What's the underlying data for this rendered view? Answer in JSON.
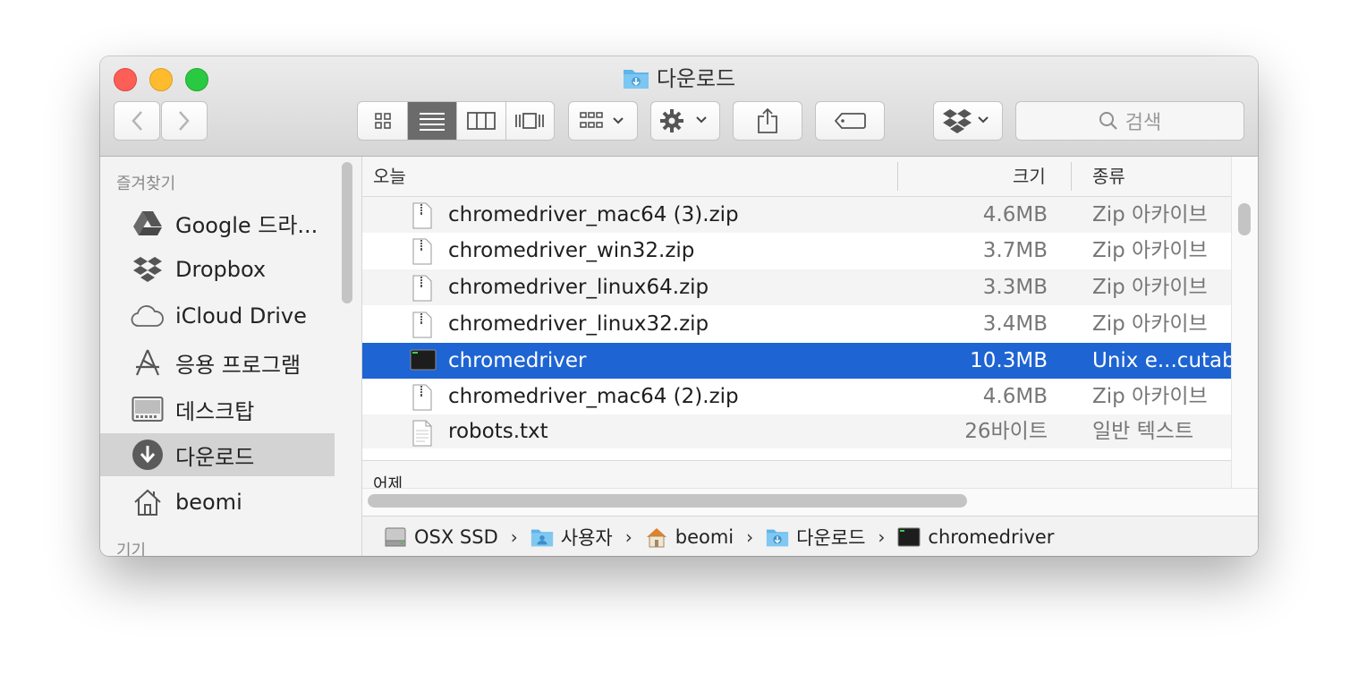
{
  "window": {
    "title": "다운로드"
  },
  "toolbar": {
    "back": "‹",
    "forward": "›",
    "search_placeholder": "검색"
  },
  "sidebar": {
    "favorites_header": "즐겨찾기",
    "items": [
      {
        "label": "Google 드라...",
        "icon": "google-drive-icon"
      },
      {
        "label": "Dropbox",
        "icon": "dropbox-icon"
      },
      {
        "label": "iCloud Drive",
        "icon": "icloud-icon"
      },
      {
        "label": "응용 프로그램",
        "icon": "applications-icon"
      },
      {
        "label": "데스크탑",
        "icon": "desktop-icon"
      },
      {
        "label": "다운로드",
        "icon": "downloads-icon",
        "selected": true
      },
      {
        "label": "beomi",
        "icon": "home-icon"
      }
    ],
    "devices_header": "기기"
  },
  "columns": {
    "name": "오늘",
    "size": "크기",
    "kind": "종류"
  },
  "files": [
    {
      "name": "chromedriver_mac64 (3).zip",
      "size": "4.6MB",
      "kind": "Zip 아카이브",
      "icon": "zip-file-icon"
    },
    {
      "name": "chromedriver_win32.zip",
      "size": "3.7MB",
      "kind": "Zip 아카이브",
      "icon": "zip-file-icon"
    },
    {
      "name": "chromedriver_linux64.zip",
      "size": "3.3MB",
      "kind": "Zip 아카이브",
      "icon": "zip-file-icon"
    },
    {
      "name": "chromedriver_linux32.zip",
      "size": "3.4MB",
      "kind": "Zip 아카이브",
      "icon": "zip-file-icon"
    },
    {
      "name": "chromedriver",
      "size": "10.3MB",
      "kind": "Unix e...cutab",
      "icon": "terminal-exec-icon",
      "selected": true
    },
    {
      "name": "chromedriver_mac64 (2).zip",
      "size": "4.6MB",
      "kind": "Zip 아카이브",
      "icon": "zip-file-icon"
    },
    {
      "name": "robots.txt",
      "size": "26바이트",
      "kind": "일반 텍스트",
      "icon": "text-file-icon"
    }
  ],
  "group2_label": "어제",
  "pathbar": [
    {
      "label": "OSX SSD",
      "icon": "hard-drive-icon"
    },
    {
      "label": "사용자",
      "icon": "users-folder-icon"
    },
    {
      "label": "beomi",
      "icon": "home-icon"
    },
    {
      "label": "다운로드",
      "icon": "downloads-folder-icon"
    },
    {
      "label": "chromedriver",
      "icon": "terminal-exec-icon"
    }
  ],
  "colors": {
    "selection": "#1e64d3",
    "folder_blue": "#5fb4e8"
  }
}
